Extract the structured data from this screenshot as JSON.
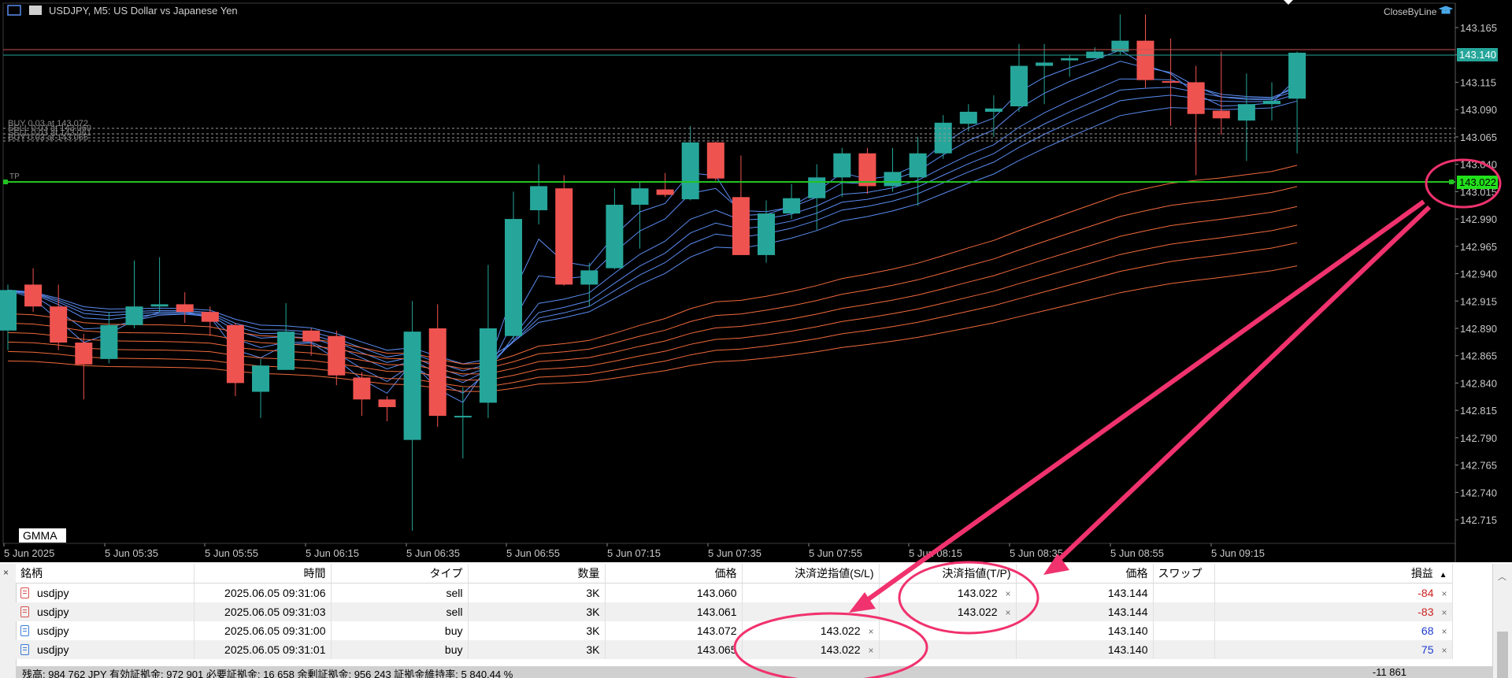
{
  "chart": {
    "symbol_title": "USDJPY, M5:  US Dollar vs Japanese Yen",
    "ea_name": "CloseByLine",
    "indicator_label": "GMMA",
    "price_axis": [
      "143.165",
      "143.140",
      "143.115",
      "143.090",
      "143.065",
      "143.040",
      "143.015",
      "142.990",
      "142.965",
      "142.940",
      "142.915",
      "142.890",
      "142.865",
      "142.840",
      "142.815",
      "142.790",
      "142.765",
      "142.740",
      "142.715"
    ],
    "time_axis": [
      "5 Jun 2025",
      "5 Jun 05:35",
      "5 Jun 05:55",
      "5 Jun 06:15",
      "5 Jun 06:35",
      "5 Jun 06:55",
      "5 Jun 07:15",
      "5 Jun 07:35",
      "5 Jun 07:55",
      "5 Jun 08:15",
      "5 Jun 08:35",
      "5 Jun 08:55",
      "5 Jun 09:15"
    ],
    "current_price": "143.140",
    "tp_price": "143.022",
    "tp_tag": "TP",
    "order_lines": [
      "BUY 0.03 at 143.072",
      "SELL 0.03 at 143.060",
      "SELL 0.03 at 143.061",
      "BUY 0.03 at 143.065"
    ],
    "colors": {
      "bull": "#26a69a",
      "bear": "#ef5350",
      "tp_line": "#22c322",
      "tp_label_bg": "#22e01c",
      "short_ema": "#5a8cf0",
      "long_ema": "#f06a3c",
      "annotation": "#f0326e",
      "price_line": "#c85050"
    },
    "candles": [
      {
        "o": 142.888,
        "h": 142.93,
        "l": 142.87,
        "c": 142.925
      },
      {
        "o": 142.93,
        "h": 142.945,
        "l": 142.905,
        "c": 142.91
      },
      {
        "o": 142.91,
        "h": 142.93,
        "l": 142.87,
        "c": 142.877
      },
      {
        "o": 142.877,
        "h": 142.885,
        "l": 142.825,
        "c": 142.857
      },
      {
        "o": 142.862,
        "h": 142.905,
        "l": 142.858,
        "c": 142.893
      },
      {
        "o": 142.893,
        "h": 142.952,
        "l": 142.89,
        "c": 142.91
      },
      {
        "o": 142.91,
        "h": 142.955,
        "l": 142.905,
        "c": 142.912
      },
      {
        "o": 142.912,
        "h": 142.923,
        "l": 142.895,
        "c": 142.905
      },
      {
        "o": 142.905,
        "h": 142.91,
        "l": 142.883,
        "c": 142.896
      },
      {
        "o": 142.893,
        "h": 142.895,
        "l": 142.828,
        "c": 142.84
      },
      {
        "o": 142.832,
        "h": 142.862,
        "l": 142.808,
        "c": 142.856
      },
      {
        "o": 142.852,
        "h": 142.913,
        "l": 142.852,
        "c": 142.887
      },
      {
        "o": 142.888,
        "h": 142.89,
        "l": 142.865,
        "c": 142.878
      },
      {
        "o": 142.883,
        "h": 142.888,
        "l": 142.838,
        "c": 142.847
      },
      {
        "o": 142.845,
        "h": 142.85,
        "l": 142.81,
        "c": 142.825
      },
      {
        "o": 142.825,
        "h": 142.828,
        "l": 142.805,
        "c": 142.818
      },
      {
        "o": 142.788,
        "h": 142.915,
        "l": 142.705,
        "c": 142.887
      },
      {
        "o": 142.89,
        "h": 142.912,
        "l": 142.8,
        "c": 142.81
      },
      {
        "o": 142.81,
        "h": 142.836,
        "l": 142.771,
        "c": 142.81
      },
      {
        "o": 142.822,
        "h": 142.948,
        "l": 142.808,
        "c": 142.89
      },
      {
        "o": 142.883,
        "h": 143.015,
        "l": 142.88,
        "c": 142.99
      },
      {
        "o": 142.998,
        "h": 143.04,
        "l": 142.985,
        "c": 143.02
      },
      {
        "o": 143.018,
        "h": 143.03,
        "l": 142.929,
        "c": 142.93
      },
      {
        "o": 142.93,
        "h": 142.95,
        "l": 142.91,
        "c": 142.943
      },
      {
        "o": 142.945,
        "h": 143.018,
        "l": 142.944,
        "c": 143.003
      },
      {
        "o": 143.003,
        "h": 143.024,
        "l": 142.963,
        "c": 143.018
      },
      {
        "o": 143.017,
        "h": 143.032,
        "l": 143.01,
        "c": 143.012
      },
      {
        "o": 143.008,
        "h": 143.075,
        "l": 143.007,
        "c": 143.06
      },
      {
        "o": 143.06,
        "h": 143.061,
        "l": 143.025,
        "c": 143.027
      },
      {
        "o": 143.01,
        "h": 143.048,
        "l": 142.978,
        "c": 142.957
      },
      {
        "o": 142.957,
        "h": 143.007,
        "l": 142.95,
        "c": 142.995
      },
      {
        "o": 142.995,
        "h": 143.022,
        "l": 142.99,
        "c": 143.009
      },
      {
        "o": 143.009,
        "h": 143.04,
        "l": 142.98,
        "c": 143.028
      },
      {
        "o": 143.028,
        "h": 143.055,
        "l": 143.01,
        "c": 143.05
      },
      {
        "o": 143.05,
        "h": 143.055,
        "l": 143.013,
        "c": 143.02
      },
      {
        "o": 143.02,
        "h": 143.055,
        "l": 143.015,
        "c": 143.033
      },
      {
        "o": 143.028,
        "h": 143.065,
        "l": 143.002,
        "c": 143.05
      },
      {
        "o": 143.05,
        "h": 143.085,
        "l": 143.045,
        "c": 143.078
      },
      {
        "o": 143.077,
        "h": 143.095,
        "l": 143.07,
        "c": 143.088
      },
      {
        "o": 143.088,
        "h": 143.103,
        "l": 143.065,
        "c": 143.091
      },
      {
        "o": 143.093,
        "h": 143.15,
        "l": 143.088,
        "c": 143.13
      },
      {
        "o": 143.13,
        "h": 143.15,
        "l": 143.095,
        "c": 143.133
      },
      {
        "o": 143.135,
        "h": 143.14,
        "l": 143.12,
        "c": 143.137
      },
      {
        "o": 143.137,
        "h": 143.147,
        "l": 143.145,
        "c": 143.143
      },
      {
        "o": 143.143,
        "h": 143.177,
        "l": 143.14,
        "c": 143.153
      },
      {
        "o": 143.153,
        "h": 143.177,
        "l": 143.11,
        "c": 143.117
      },
      {
        "o": 143.116,
        "h": 143.155,
        "l": 143.075,
        "c": 143.115
      },
      {
        "o": 143.115,
        "h": 143.13,
        "l": 143.03,
        "c": 143.086
      },
      {
        "o": 143.089,
        "h": 143.143,
        "l": 143.067,
        "c": 143.082
      },
      {
        "o": 143.08,
        "h": 143.123,
        "l": 143.043,
        "c": 143.095
      },
      {
        "o": 143.095,
        "h": 143.115,
        "l": 143.08,
        "c": 143.098
      },
      {
        "o": 143.1,
        "h": 143.143,
        "l": 143.05,
        "c": 143.142
      }
    ]
  },
  "terminal": {
    "headers": [
      "銘柄",
      "時間",
      "タイプ",
      "数量",
      "価格",
      "決済逆指値(S/L)",
      "決済指値(T/P)",
      "価格",
      "スワップ",
      "損益"
    ],
    "sort_indicator": "▲",
    "rows": [
      {
        "symbol": "usdjpy",
        "time": "2025.06.05 09:31:06",
        "type": "sell",
        "volume": "3K",
        "open_price": "143.060",
        "sl": "",
        "tp": "143.022",
        "price": "143.144",
        "swap": "",
        "profit": "-84",
        "side": "sell"
      },
      {
        "symbol": "usdjpy",
        "time": "2025.06.05 09:31:03",
        "type": "sell",
        "volume": "3K",
        "open_price": "143.061",
        "sl": "",
        "tp": "143.022",
        "price": "143.144",
        "swap": "",
        "profit": "-83",
        "side": "sell"
      },
      {
        "symbol": "usdjpy",
        "time": "2025.06.05 09:31:00",
        "type": "buy",
        "volume": "3K",
        "open_price": "143.072",
        "sl": "143.022",
        "tp": "",
        "price": "143.140",
        "swap": "",
        "profit": "68",
        "side": "buy"
      },
      {
        "symbol": "usdjpy",
        "time": "2025.06.05 09:31:01",
        "type": "buy",
        "volume": "3K",
        "open_price": "143.065",
        "sl": "143.022",
        "tp": "",
        "price": "143.140",
        "swap": "",
        "profit": "75",
        "side": "buy"
      }
    ],
    "status_text": "残高: 984 762 JPY  有効証拠金: 972 901  必要証拠金: 16 658  余剰証拠金: 956 243  証拠金維持率: 5 840.44 %",
    "total_profit": "-11 861",
    "close_symbol": "×"
  }
}
